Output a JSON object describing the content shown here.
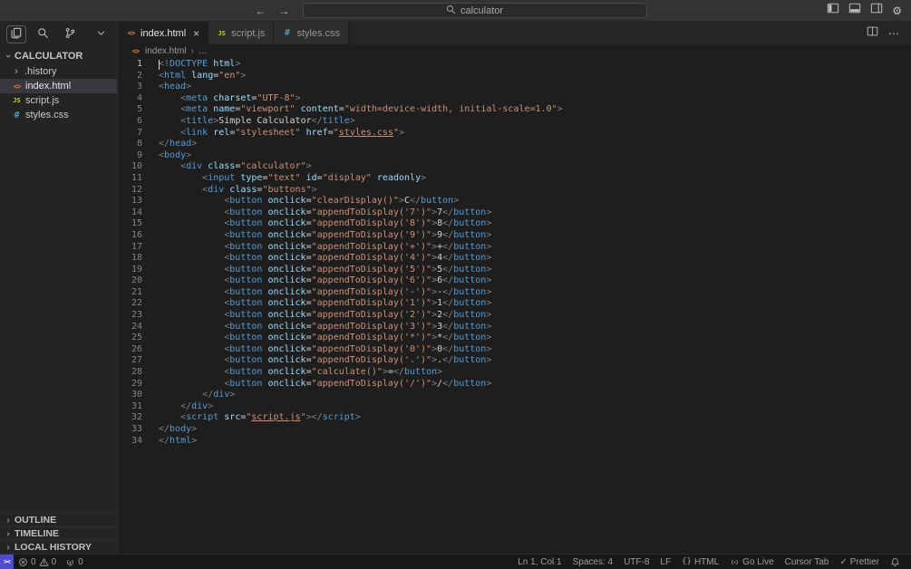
{
  "titlebar": {
    "search_value": "calculator"
  },
  "icons": {
    "back": "←",
    "forward": "→",
    "close": "×",
    "chevron": "›",
    "ellipsis": "⋯",
    "check": "✓",
    "gear": "⚙",
    "remote": "><",
    "html_file": "<>",
    "js_file": "JS",
    "css_file": "#",
    "language_mode": "{}"
  },
  "sidebar": {
    "title": "CALCULATOR",
    "files": [
      {
        "name": ".history"
      },
      {
        "name": "index.html"
      },
      {
        "name": "script.js"
      },
      {
        "name": "styles.css"
      }
    ],
    "sections": [
      "OUTLINE",
      "TIMELINE",
      "LOCAL HISTORY"
    ]
  },
  "tabs": [
    {
      "label": "index.html"
    },
    {
      "label": "script.js"
    },
    {
      "label": "styles.css"
    }
  ],
  "breadcrumb": {
    "file": "index.html",
    "separator": "›",
    "more": "…"
  },
  "statusbar": {
    "errors": "0",
    "warnings": "0",
    "ports": "0",
    "cursor_position": "Ln 1, Col 1",
    "indentation": "Spaces: 4",
    "encoding": "UTF-8",
    "eol": "LF",
    "language": "HTML",
    "go_live": "Go Live",
    "cursor_tab": "Cursor Tab",
    "prettier": "Prettier"
  },
  "colors": {
    "html_icon": "#e37933",
    "js_icon": "#cbcb41",
    "css_icon": "#519aba",
    "tag": "#569cd6",
    "attribute": "#9cdcfe",
    "string": "#ce9178",
    "punctuation": "#808080",
    "selected_row": "#37373d",
    "remote_indicator": "#4f4cce"
  },
  "editor": {
    "lines": [
      [
        [
          "p",
          "<!"
        ],
        [
          "t",
          "DOCTYPE"
        ],
        [
          "x",
          " "
        ],
        [
          "a",
          "html"
        ],
        [
          "p",
          ">"
        ]
      ],
      [
        [
          "p",
          "<"
        ],
        [
          "t",
          "html"
        ],
        [
          "x",
          " "
        ],
        [
          "a",
          "lang"
        ],
        [
          "x",
          "="
        ],
        [
          "s",
          "\"en\""
        ],
        [
          "p",
          ">"
        ]
      ],
      [
        [
          "p",
          "<"
        ],
        [
          "t",
          "head"
        ],
        [
          "p",
          ">"
        ]
      ],
      [
        [
          "x",
          "    "
        ],
        [
          "p",
          "<"
        ],
        [
          "t",
          "meta"
        ],
        [
          "x",
          " "
        ],
        [
          "a",
          "charset"
        ],
        [
          "x",
          "="
        ],
        [
          "s",
          "\"UTF-8\""
        ],
        [
          "p",
          ">"
        ]
      ],
      [
        [
          "x",
          "    "
        ],
        [
          "p",
          "<"
        ],
        [
          "t",
          "meta"
        ],
        [
          "x",
          " "
        ],
        [
          "a",
          "name"
        ],
        [
          "x",
          "="
        ],
        [
          "s",
          "\"viewport\""
        ],
        [
          "x",
          " "
        ],
        [
          "a",
          "content"
        ],
        [
          "x",
          "="
        ],
        [
          "s",
          "\"width=device-width, initial-scale=1.0\""
        ],
        [
          "p",
          ">"
        ]
      ],
      [
        [
          "x",
          "    "
        ],
        [
          "p",
          "<"
        ],
        [
          "t",
          "title"
        ],
        [
          "p",
          ">"
        ],
        [
          "x",
          "Simple Calculator"
        ],
        [
          "p",
          "</"
        ],
        [
          "t",
          "title"
        ],
        [
          "p",
          ">"
        ]
      ],
      [
        [
          "x",
          "    "
        ],
        [
          "p",
          "<"
        ],
        [
          "t",
          "link"
        ],
        [
          "x",
          " "
        ],
        [
          "a",
          "rel"
        ],
        [
          "x",
          "="
        ],
        [
          "s",
          "\"stylesheet\""
        ],
        [
          "x",
          " "
        ],
        [
          "a",
          "href"
        ],
        [
          "x",
          "="
        ],
        [
          "s",
          "\""
        ],
        [
          "l",
          "styles.css"
        ],
        [
          "s",
          "\""
        ],
        [
          "p",
          ">"
        ]
      ],
      [
        [
          "p",
          "</"
        ],
        [
          "t",
          "head"
        ],
        [
          "p",
          ">"
        ]
      ],
      [
        [
          "p",
          "<"
        ],
        [
          "t",
          "body"
        ],
        [
          "p",
          ">"
        ]
      ],
      [
        [
          "x",
          "    "
        ],
        [
          "p",
          "<"
        ],
        [
          "t",
          "div"
        ],
        [
          "x",
          " "
        ],
        [
          "a",
          "class"
        ],
        [
          "x",
          "="
        ],
        [
          "s",
          "\"calculator\""
        ],
        [
          "p",
          ">"
        ]
      ],
      [
        [
          "x",
          "        "
        ],
        [
          "p",
          "<"
        ],
        [
          "t",
          "input"
        ],
        [
          "x",
          " "
        ],
        [
          "a",
          "type"
        ],
        [
          "x",
          "="
        ],
        [
          "s",
          "\"text\""
        ],
        [
          "x",
          " "
        ],
        [
          "a",
          "id"
        ],
        [
          "x",
          "="
        ],
        [
          "s",
          "\"display\""
        ],
        [
          "x",
          " "
        ],
        [
          "a",
          "readonly"
        ],
        [
          "p",
          ">"
        ]
      ],
      [
        [
          "x",
          "        "
        ],
        [
          "p",
          "<"
        ],
        [
          "t",
          "div"
        ],
        [
          "x",
          " "
        ],
        [
          "a",
          "class"
        ],
        [
          "x",
          "="
        ],
        [
          "s",
          "\"buttons\""
        ],
        [
          "p",
          ">"
        ]
      ],
      [
        [
          "x",
          "            "
        ],
        [
          "p",
          "<"
        ],
        [
          "t",
          "button"
        ],
        [
          "x",
          " "
        ],
        [
          "a",
          "onclick"
        ],
        [
          "x",
          "="
        ],
        [
          "s",
          "\"clearDisplay()\""
        ],
        [
          "p",
          ">"
        ],
        [
          "x",
          "C"
        ],
        [
          "p",
          "</"
        ],
        [
          "t",
          "button"
        ],
        [
          "p",
          ">"
        ]
      ],
      [
        [
          "x",
          "            "
        ],
        [
          "p",
          "<"
        ],
        [
          "t",
          "button"
        ],
        [
          "x",
          " "
        ],
        [
          "a",
          "onclick"
        ],
        [
          "x",
          "="
        ],
        [
          "s",
          "\"appendToDisplay('7')\""
        ],
        [
          "p",
          ">"
        ],
        [
          "x",
          "7"
        ],
        [
          "p",
          "</"
        ],
        [
          "t",
          "button"
        ],
        [
          "p",
          ">"
        ]
      ],
      [
        [
          "x",
          "            "
        ],
        [
          "p",
          "<"
        ],
        [
          "t",
          "button"
        ],
        [
          "x",
          " "
        ],
        [
          "a",
          "onclick"
        ],
        [
          "x",
          "="
        ],
        [
          "s",
          "\"appendToDisplay('8')\""
        ],
        [
          "p",
          ">"
        ],
        [
          "x",
          "8"
        ],
        [
          "p",
          "</"
        ],
        [
          "t",
          "button"
        ],
        [
          "p",
          ">"
        ]
      ],
      [
        [
          "x",
          "            "
        ],
        [
          "p",
          "<"
        ],
        [
          "t",
          "button"
        ],
        [
          "x",
          " "
        ],
        [
          "a",
          "onclick"
        ],
        [
          "x",
          "="
        ],
        [
          "s",
          "\"appendToDisplay('9')\""
        ],
        [
          "p",
          ">"
        ],
        [
          "x",
          "9"
        ],
        [
          "p",
          "</"
        ],
        [
          "t",
          "button"
        ],
        [
          "p",
          ">"
        ]
      ],
      [
        [
          "x",
          "            "
        ],
        [
          "p",
          "<"
        ],
        [
          "t",
          "button"
        ],
        [
          "x",
          " "
        ],
        [
          "a",
          "onclick"
        ],
        [
          "x",
          "="
        ],
        [
          "s",
          "\"appendToDisplay('+')\""
        ],
        [
          "p",
          ">"
        ],
        [
          "x",
          "+"
        ],
        [
          "p",
          "</"
        ],
        [
          "t",
          "button"
        ],
        [
          "p",
          ">"
        ]
      ],
      [
        [
          "x",
          "            "
        ],
        [
          "p",
          "<"
        ],
        [
          "t",
          "button"
        ],
        [
          "x",
          " "
        ],
        [
          "a",
          "onclick"
        ],
        [
          "x",
          "="
        ],
        [
          "s",
          "\"appendToDisplay('4')\""
        ],
        [
          "p",
          ">"
        ],
        [
          "x",
          "4"
        ],
        [
          "p",
          "</"
        ],
        [
          "t",
          "button"
        ],
        [
          "p",
          ">"
        ]
      ],
      [
        [
          "x",
          "            "
        ],
        [
          "p",
          "<"
        ],
        [
          "t",
          "button"
        ],
        [
          "x",
          " "
        ],
        [
          "a",
          "onclick"
        ],
        [
          "x",
          "="
        ],
        [
          "s",
          "\"appendToDisplay('5')\""
        ],
        [
          "p",
          ">"
        ],
        [
          "x",
          "5"
        ],
        [
          "p",
          "</"
        ],
        [
          "t",
          "button"
        ],
        [
          "p",
          ">"
        ]
      ],
      [
        [
          "x",
          "            "
        ],
        [
          "p",
          "<"
        ],
        [
          "t",
          "button"
        ],
        [
          "x",
          " "
        ],
        [
          "a",
          "onclick"
        ],
        [
          "x",
          "="
        ],
        [
          "s",
          "\"appendToDisplay('6')\""
        ],
        [
          "p",
          ">"
        ],
        [
          "x",
          "6"
        ],
        [
          "p",
          "</"
        ],
        [
          "t",
          "button"
        ],
        [
          "p",
          ">"
        ]
      ],
      [
        [
          "x",
          "            "
        ],
        [
          "p",
          "<"
        ],
        [
          "t",
          "button"
        ],
        [
          "x",
          " "
        ],
        [
          "a",
          "onclick"
        ],
        [
          "x",
          "="
        ],
        [
          "s",
          "\"appendToDisplay('-')\""
        ],
        [
          "p",
          ">"
        ],
        [
          "x",
          "-"
        ],
        [
          "p",
          "</"
        ],
        [
          "t",
          "button"
        ],
        [
          "p",
          ">"
        ]
      ],
      [
        [
          "x",
          "            "
        ],
        [
          "p",
          "<"
        ],
        [
          "t",
          "button"
        ],
        [
          "x",
          " "
        ],
        [
          "a",
          "onclick"
        ],
        [
          "x",
          "="
        ],
        [
          "s",
          "\"appendToDisplay('1')\""
        ],
        [
          "p",
          ">"
        ],
        [
          "x",
          "1"
        ],
        [
          "p",
          "</"
        ],
        [
          "t",
          "button"
        ],
        [
          "p",
          ">"
        ]
      ],
      [
        [
          "x",
          "            "
        ],
        [
          "p",
          "<"
        ],
        [
          "t",
          "button"
        ],
        [
          "x",
          " "
        ],
        [
          "a",
          "onclick"
        ],
        [
          "x",
          "="
        ],
        [
          "s",
          "\"appendToDisplay('2')\""
        ],
        [
          "p",
          ">"
        ],
        [
          "x",
          "2"
        ],
        [
          "p",
          "</"
        ],
        [
          "t",
          "button"
        ],
        [
          "p",
          ">"
        ]
      ],
      [
        [
          "x",
          "            "
        ],
        [
          "p",
          "<"
        ],
        [
          "t",
          "button"
        ],
        [
          "x",
          " "
        ],
        [
          "a",
          "onclick"
        ],
        [
          "x",
          "="
        ],
        [
          "s",
          "\"appendToDisplay('3')\""
        ],
        [
          "p",
          ">"
        ],
        [
          "x",
          "3"
        ],
        [
          "p",
          "</"
        ],
        [
          "t",
          "button"
        ],
        [
          "p",
          ">"
        ]
      ],
      [
        [
          "x",
          "            "
        ],
        [
          "p",
          "<"
        ],
        [
          "t",
          "button"
        ],
        [
          "x",
          " "
        ],
        [
          "a",
          "onclick"
        ],
        [
          "x",
          "="
        ],
        [
          "s",
          "\"appendToDisplay('*')\""
        ],
        [
          "p",
          ">"
        ],
        [
          "x",
          "*"
        ],
        [
          "p",
          "</"
        ],
        [
          "t",
          "button"
        ],
        [
          "p",
          ">"
        ]
      ],
      [
        [
          "x",
          "            "
        ],
        [
          "p",
          "<"
        ],
        [
          "t",
          "button"
        ],
        [
          "x",
          " "
        ],
        [
          "a",
          "onclick"
        ],
        [
          "x",
          "="
        ],
        [
          "s",
          "\"appendToDisplay('0')\""
        ],
        [
          "p",
          ">"
        ],
        [
          "x",
          "0"
        ],
        [
          "p",
          "</"
        ],
        [
          "t",
          "button"
        ],
        [
          "p",
          ">"
        ]
      ],
      [
        [
          "x",
          "            "
        ],
        [
          "p",
          "<"
        ],
        [
          "t",
          "button"
        ],
        [
          "x",
          " "
        ],
        [
          "a",
          "onclick"
        ],
        [
          "x",
          "="
        ],
        [
          "s",
          "\"appendToDisplay('.')\""
        ],
        [
          "p",
          ">"
        ],
        [
          "x",
          "."
        ],
        [
          "p",
          "</"
        ],
        [
          "t",
          "button"
        ],
        [
          "p",
          ">"
        ]
      ],
      [
        [
          "x",
          "            "
        ],
        [
          "p",
          "<"
        ],
        [
          "t",
          "button"
        ],
        [
          "x",
          " "
        ],
        [
          "a",
          "onclick"
        ],
        [
          "x",
          "="
        ],
        [
          "s",
          "\"calculate()\""
        ],
        [
          "p",
          ">"
        ],
        [
          "x",
          "="
        ],
        [
          "p",
          "</"
        ],
        [
          "t",
          "button"
        ],
        [
          "p",
          ">"
        ]
      ],
      [
        [
          "x",
          "            "
        ],
        [
          "p",
          "<"
        ],
        [
          "t",
          "button"
        ],
        [
          "x",
          " "
        ],
        [
          "a",
          "onclick"
        ],
        [
          "x",
          "="
        ],
        [
          "s",
          "\"appendToDisplay('/')\""
        ],
        [
          "p",
          ">"
        ],
        [
          "x",
          "/"
        ],
        [
          "p",
          "</"
        ],
        [
          "t",
          "button"
        ],
        [
          "p",
          ">"
        ]
      ],
      [
        [
          "x",
          "        "
        ],
        [
          "p",
          "</"
        ],
        [
          "t",
          "div"
        ],
        [
          "p",
          ">"
        ]
      ],
      [
        [
          "x",
          "    "
        ],
        [
          "p",
          "</"
        ],
        [
          "t",
          "div"
        ],
        [
          "p",
          ">"
        ]
      ],
      [
        [
          "x",
          "    "
        ],
        [
          "p",
          "<"
        ],
        [
          "t",
          "script"
        ],
        [
          "x",
          " "
        ],
        [
          "a",
          "src"
        ],
        [
          "x",
          "="
        ],
        [
          "s",
          "\""
        ],
        [
          "l",
          "script.js"
        ],
        [
          "s",
          "\""
        ],
        [
          "p",
          ">"
        ],
        [
          "p",
          "</"
        ],
        [
          "t",
          "script"
        ],
        [
          "p",
          ">"
        ]
      ],
      [
        [
          "p",
          "</"
        ],
        [
          "t",
          "body"
        ],
        [
          "p",
          ">"
        ]
      ],
      [
        [
          "p",
          "</"
        ],
        [
          "t",
          "html"
        ],
        [
          "p",
          ">"
        ]
      ]
    ]
  }
}
